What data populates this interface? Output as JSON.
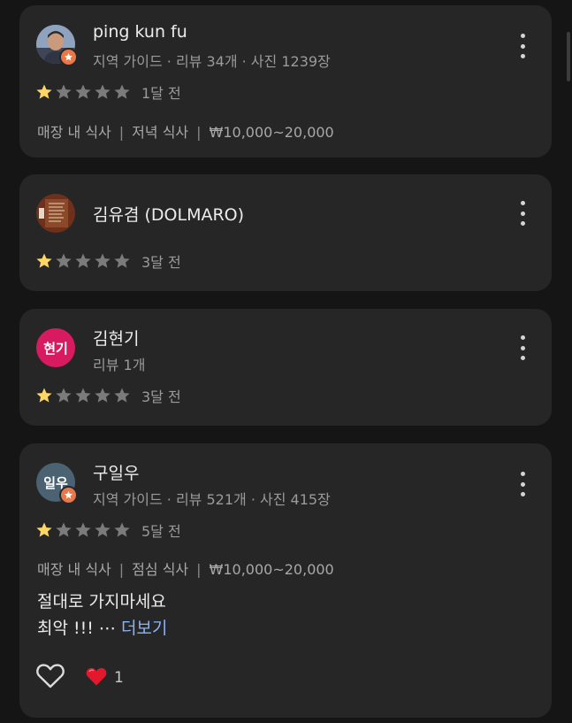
{
  "reviews": [
    {
      "name": "ping kun fu",
      "meta": "지역 가이드 · 리뷰 34개 · 사진 1239장",
      "avatar": {
        "kind": "photo",
        "color": "#5b6f8a"
      },
      "guide_badge": true,
      "rating": 1,
      "time": "1달 전",
      "tags": [
        "매장 내 식사",
        "저녁 식사",
        "₩10,000~20,000"
      ]
    },
    {
      "name": "김유겸 (DOLMARO)",
      "meta": "",
      "avatar": {
        "kind": "photo",
        "color": "#7a3a22"
      },
      "guide_badge": false,
      "rating": 1,
      "time": "3달 전",
      "tags": []
    },
    {
      "name": "김현기",
      "meta": "리뷰 1개",
      "avatar": {
        "kind": "initials",
        "text": "현기",
        "color": "#d81b60"
      },
      "guide_badge": false,
      "rating": 1,
      "time": "3달 전",
      "tags": []
    },
    {
      "name": "구일우",
      "meta": "지역 가이드 · 리뷰 521개 · 사진 415장",
      "avatar": {
        "kind": "initials",
        "text": "일우",
        "color": "#4a6272"
      },
      "guide_badge": true,
      "rating": 1,
      "time": "5달 전",
      "tags": [
        "매장 내 식사",
        "점심 식사",
        "₩10,000~20,000"
      ],
      "text_line1": "절대로 가지마세요",
      "text_line2": "최악 !!! ⋯ ",
      "more_label": "더보기",
      "like_count": "1"
    }
  ],
  "colors": {
    "star_filled": "#fdd663",
    "star_empty": "#7b7b7b",
    "link": "#8ab4f8",
    "heart": "#e3182d"
  },
  "icons": [
    "guide-badge-icon",
    "star-icon",
    "more-vert-icon",
    "heart-outline-icon",
    "heart-emoji-icon"
  ]
}
